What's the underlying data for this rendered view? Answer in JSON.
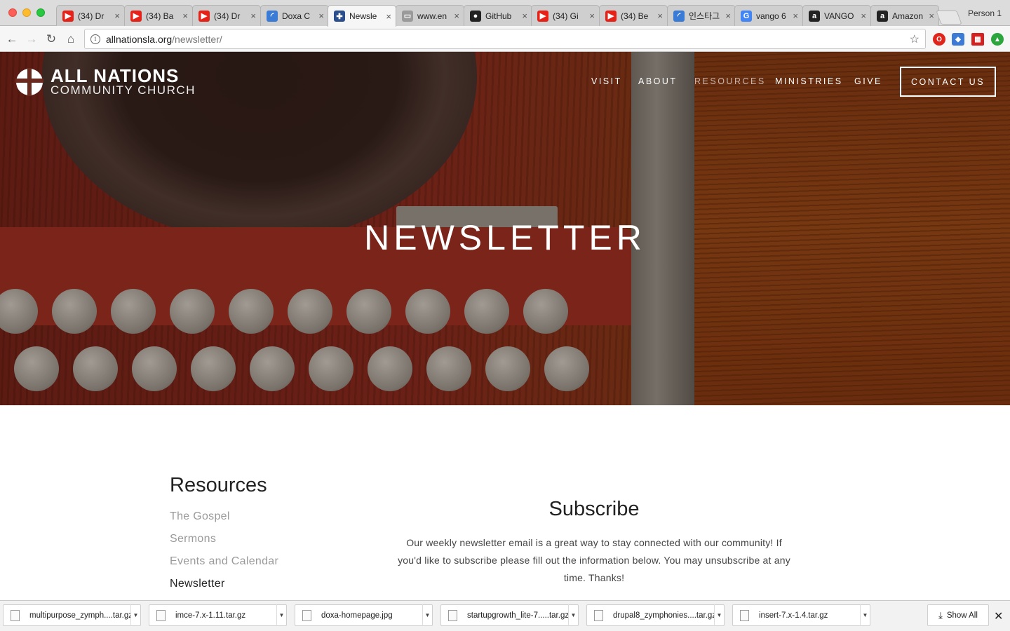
{
  "browser": {
    "tabs": [
      {
        "title": "(34) Dr",
        "icon": "youtube-icon",
        "color": "#e62117",
        "glyph": "▶"
      },
      {
        "title": "(34) Ba",
        "icon": "youtube-icon",
        "color": "#e62117",
        "glyph": "▶"
      },
      {
        "title": "(34) Dr",
        "icon": "youtube-icon",
        "color": "#e62117",
        "glyph": "▶"
      },
      {
        "title": "Doxa C",
        "icon": "loading-icon",
        "color": "#3a7bd5",
        "glyph": "◜"
      },
      {
        "title": "Newsle",
        "icon": "church-icon",
        "color": "#2b4e8c",
        "glyph": "✚",
        "active": true
      },
      {
        "title": "www.en",
        "icon": "page-icon",
        "color": "#9a9a9a",
        "glyph": "▭"
      },
      {
        "title": "GitHub",
        "icon": "github-icon",
        "color": "#222222",
        "glyph": "●"
      },
      {
        "title": "(34) Gi",
        "icon": "youtube-icon",
        "color": "#e62117",
        "glyph": "▶"
      },
      {
        "title": "(34) Be",
        "icon": "youtube-icon",
        "color": "#e62117",
        "glyph": "▶"
      },
      {
        "title": "인스타그",
        "icon": "loading-icon",
        "color": "#3a7bd5",
        "glyph": "◜"
      },
      {
        "title": "vango 6",
        "icon": "google-icon",
        "color": "#4285f4",
        "glyph": "G"
      },
      {
        "title": "VANGO",
        "icon": "amazon-icon",
        "color": "#222222",
        "glyph": "a"
      },
      {
        "title": "Amazon",
        "icon": "amazon-icon",
        "color": "#222222",
        "glyph": "a"
      }
    ],
    "profile": "Person 1",
    "url_host": "allnationsla.org",
    "url_path": "/newsletter/"
  },
  "site": {
    "logo_main": "ALL NATIONS",
    "logo_sub": "COMMUNITY CHURCH",
    "nav": {
      "visit": "VISIT",
      "about": "ABOUT",
      "resources": "RESOURCES",
      "ministries": "MINISTRIES",
      "give": "GIVE",
      "contact": "CONTACT US"
    },
    "hero_title": "NEWSLETTER",
    "sidebar": {
      "title": "Resources",
      "links": [
        "The Gospel",
        "Sermons",
        "Events and Calendar",
        "Newsletter"
      ]
    },
    "subscribe": {
      "title": "Subscribe",
      "text": "Our weekly newsletter email is a great way to stay connected with our community! If you'd like to subscribe please fill out the information below. You may unsubscribe at any time. Thanks!"
    }
  },
  "downloads": {
    "items": [
      "multipurpose_zymph....tar.gz",
      "imce-7.x-1.11.tar.gz",
      "doxa-homepage.jpg",
      "startupgrowth_lite-7.....tar.gz",
      "drupal8_zymphonies....tar.gz",
      "insert-7.x-1.4.tar.gz"
    ],
    "show_all": "Show All"
  }
}
